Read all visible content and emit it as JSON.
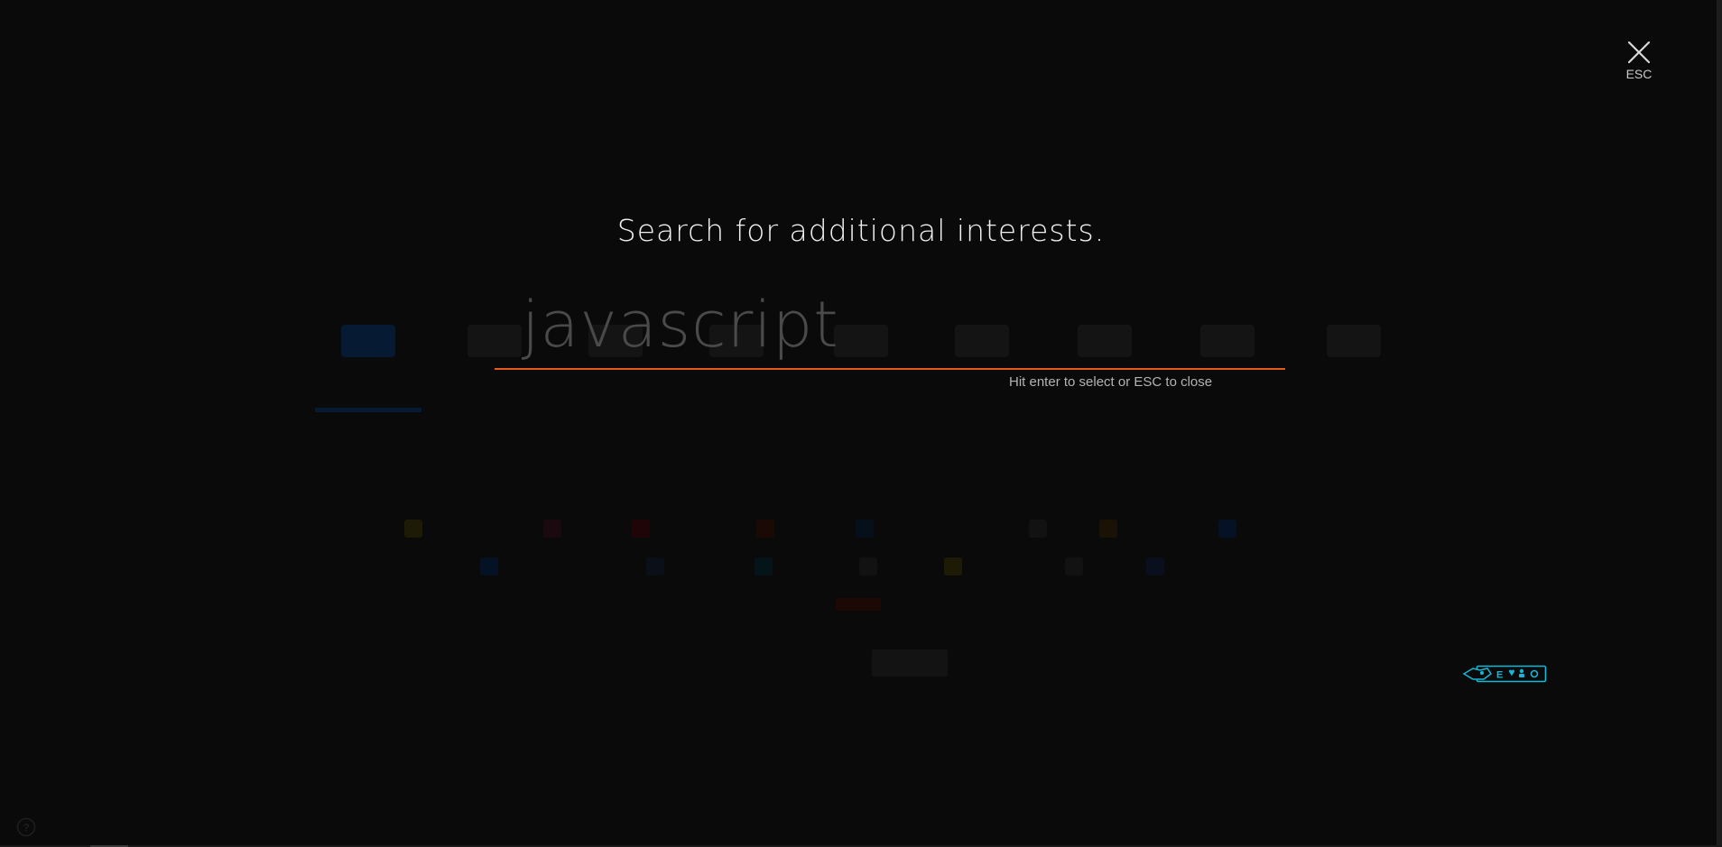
{
  "search": {
    "title": "Search for additional interests.",
    "placeholder": "javascript",
    "value": "",
    "hint": "Hit enter to select or ESC to close",
    "underline_color": "#e65a1a"
  },
  "close": {
    "label": "ESC",
    "icon": "close-icon"
  },
  "widgets": {
    "accessibility_icon": "accessibility-badge-icon",
    "help_icon": "help-icon"
  },
  "colors": {
    "background": "#0a0a0a",
    "overlay_text": "#f0f0f0",
    "accent": "#e65a1a",
    "badge": "#16b7d6"
  }
}
